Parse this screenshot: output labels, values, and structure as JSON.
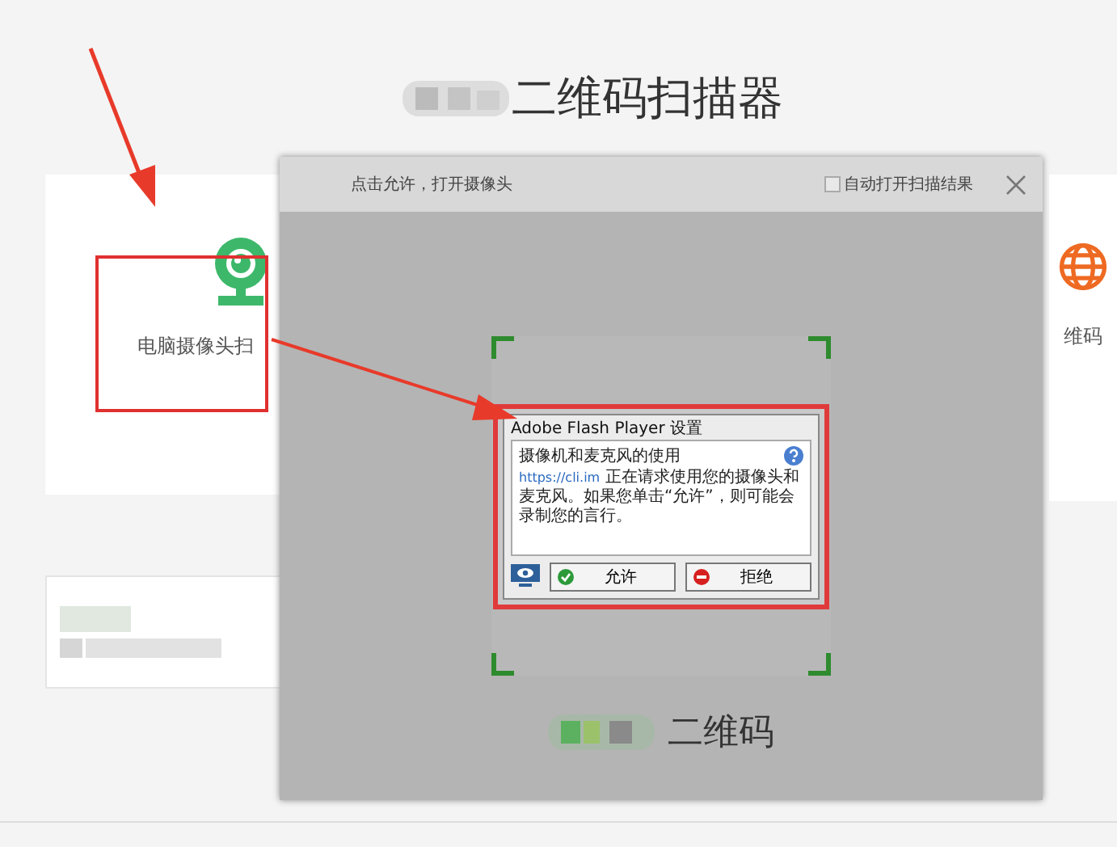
{
  "page": {
    "title": "二维码扫描器",
    "cards": [
      {
        "label": "电脑摄像头扫",
        "kind": "camera"
      },
      {
        "label": "维码",
        "kind": "globe"
      }
    ]
  },
  "dialog": {
    "title": "点击允许，打开摄像头",
    "auto_open": {
      "label": "自动打开扫描结果",
      "checked": false
    },
    "flash_prompt": {
      "title": "Adobe Flash Player 设置",
      "heading": "摄像机和麦克风的使用",
      "link": "https://cli.im",
      "message": "正在请求使用您的摄像头和麦克风。如果您单击“允许”，则可能会录制您的言行。",
      "buttons": [
        {
          "label": "允许",
          "kind": "allow"
        },
        {
          "label": "拒绝",
          "kind": "deny"
        }
      ]
    },
    "footer_text": "二维码"
  }
}
